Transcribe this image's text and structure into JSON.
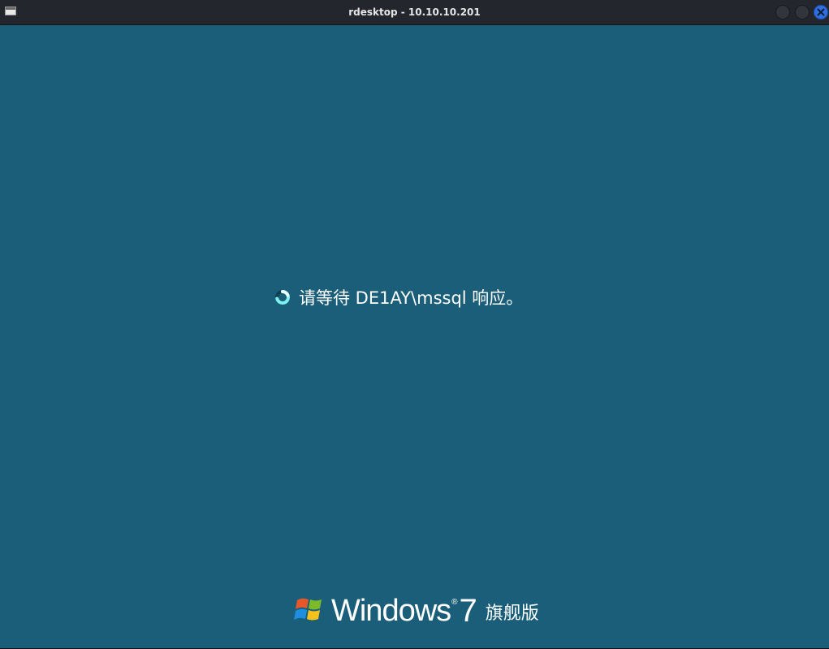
{
  "window": {
    "title": "rdesktop - 10.10.10.201",
    "app_icon": "window-icon",
    "buttons": {
      "minimize": "minimize-icon",
      "maximize": "maximize-icon",
      "close": "close-icon"
    }
  },
  "session": {
    "status_message": "请等待 DE1AY\\mssql 响应。",
    "spinner_icon": "loading-spinner-icon"
  },
  "branding": {
    "logo_icon": "windows-flag-icon",
    "product_name": "Windows",
    "registered_mark": "®",
    "version": "7",
    "edition": "旗舰版"
  },
  "colors": {
    "desktop_background": "#1a5e79",
    "titlebar": "#24262d",
    "close_button": "#2f6fe0"
  }
}
